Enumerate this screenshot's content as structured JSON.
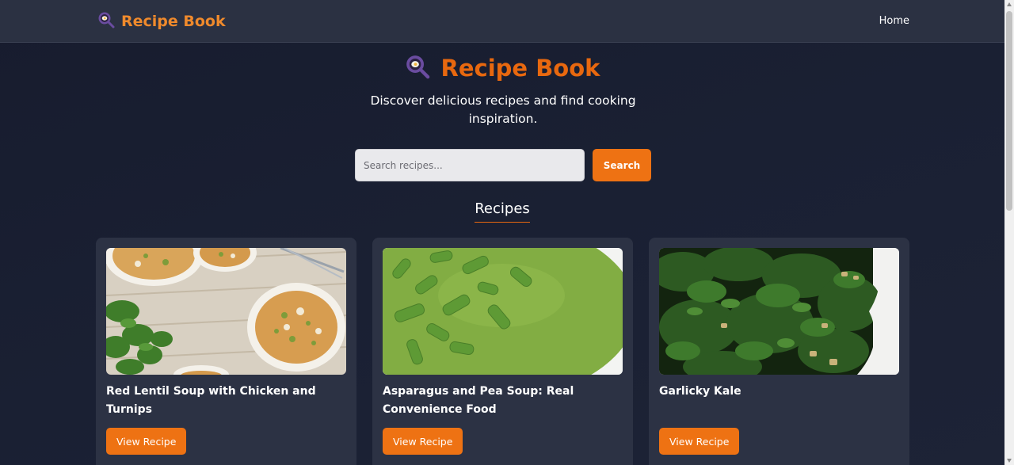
{
  "nav": {
    "brand": "Recipe Book",
    "home_link": "Home"
  },
  "hero": {
    "title": "Recipe Book",
    "subtitle": "Discover delicious recipes and find cooking inspiration."
  },
  "search": {
    "placeholder": "Search recipes...",
    "button_label": "Search"
  },
  "section": {
    "title": "Recipes"
  },
  "recipes": [
    {
      "title": "Red Lentil Soup with Chicken and Turnips",
      "button_label": "View Recipe",
      "image": "lentil-soup-photo"
    },
    {
      "title": "Asparagus and Pea Soup: Real Convenience Food",
      "button_label": "View Recipe",
      "image": "pea-soup-photo"
    },
    {
      "title": "Garlicky Kale",
      "button_label": "View Recipe",
      "image": "kale-photo"
    }
  ],
  "colors": {
    "accent": "#ee7213",
    "brand_text": "#f08a2c",
    "hero_title": "#e8680f",
    "navbar_bg": "#2b3142",
    "card_bg": "#2c3244",
    "page_bg": "#1a2033"
  },
  "icons": {
    "logo": "magnifier-plate-icon"
  }
}
